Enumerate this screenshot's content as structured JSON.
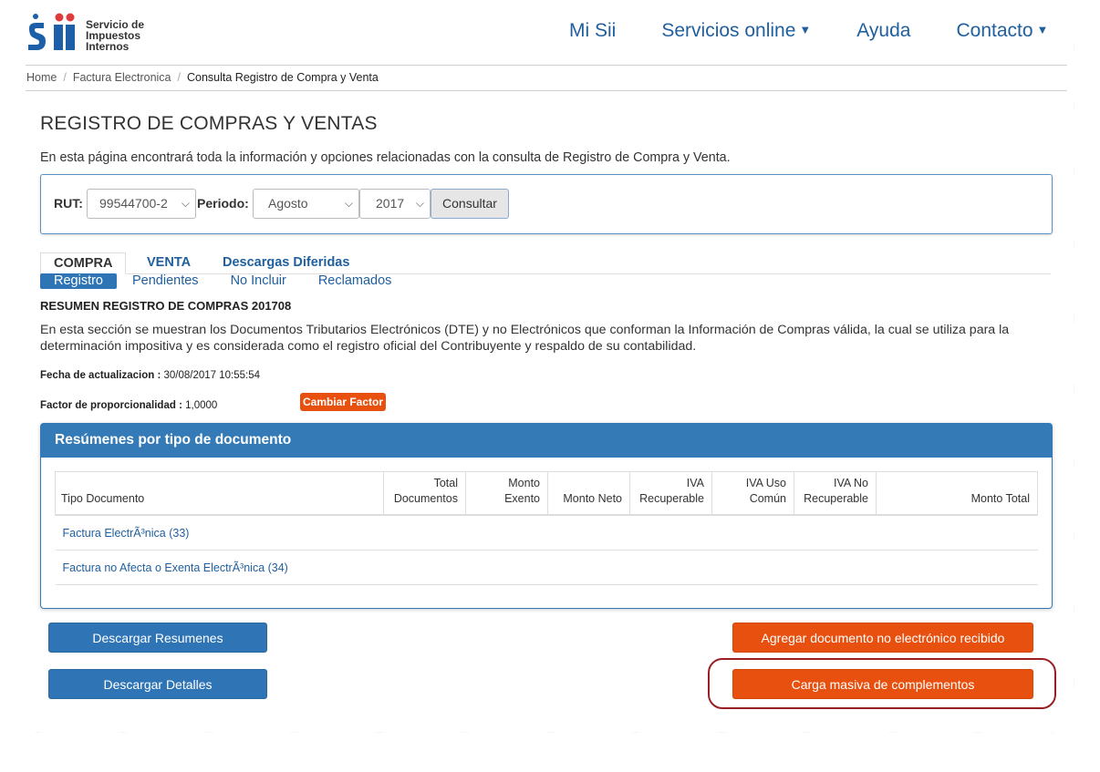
{
  "header": {
    "logo_mark": "Sii",
    "logo_text": [
      "Servicio de",
      "Impuestos",
      "Internos"
    ],
    "nav": [
      {
        "label": "Mi Sii",
        "dropdown": false
      },
      {
        "label": "Servicios online",
        "dropdown": true
      },
      {
        "label": "Ayuda",
        "dropdown": false
      },
      {
        "label": "Contacto",
        "dropdown": true
      }
    ]
  },
  "breadcrumb": [
    "Home",
    "Factura Electronica",
    "Consulta Registro de Compra y Venta"
  ],
  "page": {
    "title": "REGISTRO DE COMPRAS Y VENTAS",
    "intro": "En esta página encontrará toda la información y opciones relacionadas con la consulta de Registro de Compra y Venta."
  },
  "filter": {
    "rut_label": "RUT:",
    "rut_value": "99544700-2",
    "periodo_label": "Periodo:",
    "month_value": "Agosto",
    "year_value": "2017",
    "consult_label": "Consultar"
  },
  "tabs": [
    {
      "label": "COMPRA",
      "active": true
    },
    {
      "label": "VENTA",
      "active": false
    },
    {
      "label": "Descargas Diferidas",
      "active": false
    }
  ],
  "subtabs": [
    {
      "label": "Registro",
      "active": true
    },
    {
      "label": "Pendientes",
      "active": false
    },
    {
      "label": "No Incluir",
      "active": false
    },
    {
      "label": "Reclamados",
      "active": false
    }
  ],
  "resumen": {
    "title": "RESUMEN REGISTRO DE COMPRAS 201708",
    "description": "En esta sección se muestran los Documentos Tributarios Electrónicos (DTE) y no Electrónicos que conforman la Información de Compras válida, la cual se utiliza para la determinación impositiva y es considerada como el registro oficial del Contribuyente y respaldo de su contabilidad.",
    "fecha_label": "Fecha de actualizacion :",
    "fecha_value": "30/08/2017 10:55:54",
    "factor_label": "Factor de proporcionalidad :",
    "factor_value": "1,0000",
    "cambiar_factor": "Cambiar Factor"
  },
  "panel": {
    "title": "Resúmenes por tipo de documento",
    "columns": [
      [
        "Tipo Documento"
      ],
      [
        "Total",
        "Documentos"
      ],
      [
        "Monto",
        "Exento"
      ],
      [
        "Monto Neto"
      ],
      [
        "IVA",
        "Recuperable"
      ],
      [
        "IVA Uso",
        "Común"
      ],
      [
        "IVA No",
        "Recuperable"
      ],
      [
        "Monto Total"
      ]
    ],
    "rows": [
      "Factura ElectrÃ³nica (33)",
      "Factura no Afecta o Exenta ElectrÃ³nica (34)"
    ]
  },
  "actions": {
    "descargar_resumenes": "Descargar Resumenes",
    "descargar_detalles": "Descargar Detalles",
    "agregar_documento": "Agregar documento no electrónico recibido",
    "carga_masiva": "Carga masiva de complementos"
  },
  "colors": {
    "primary_blue": "#2f75b5",
    "panel_blue": "#337ab7",
    "orange": "#e8500f",
    "highlight_ring": "#9a1f25",
    "logo_blue": "#1c5fa8",
    "logo_red": "#e03b3b"
  }
}
